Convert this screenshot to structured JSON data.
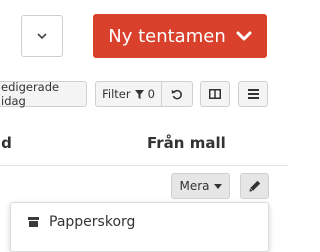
{
  "header": {
    "new_exam_label": "Ny tentamen"
  },
  "toolbar": {
    "edited_today_label": "edigerade idag",
    "filter_label": "Filter",
    "filter_count": "0"
  },
  "table": {
    "columns": [
      {
        "label": "id"
      },
      {
        "label": "Från mall"
      }
    ]
  },
  "row_actions": {
    "more_label": "Mera"
  },
  "dropdown": {
    "items": [
      {
        "label": "Papperskorg",
        "icon": "archive-icon"
      }
    ]
  },
  "colors": {
    "primary": "#d9412c",
    "button_background": "#f4f4f4",
    "border": "#d0d0d0"
  }
}
